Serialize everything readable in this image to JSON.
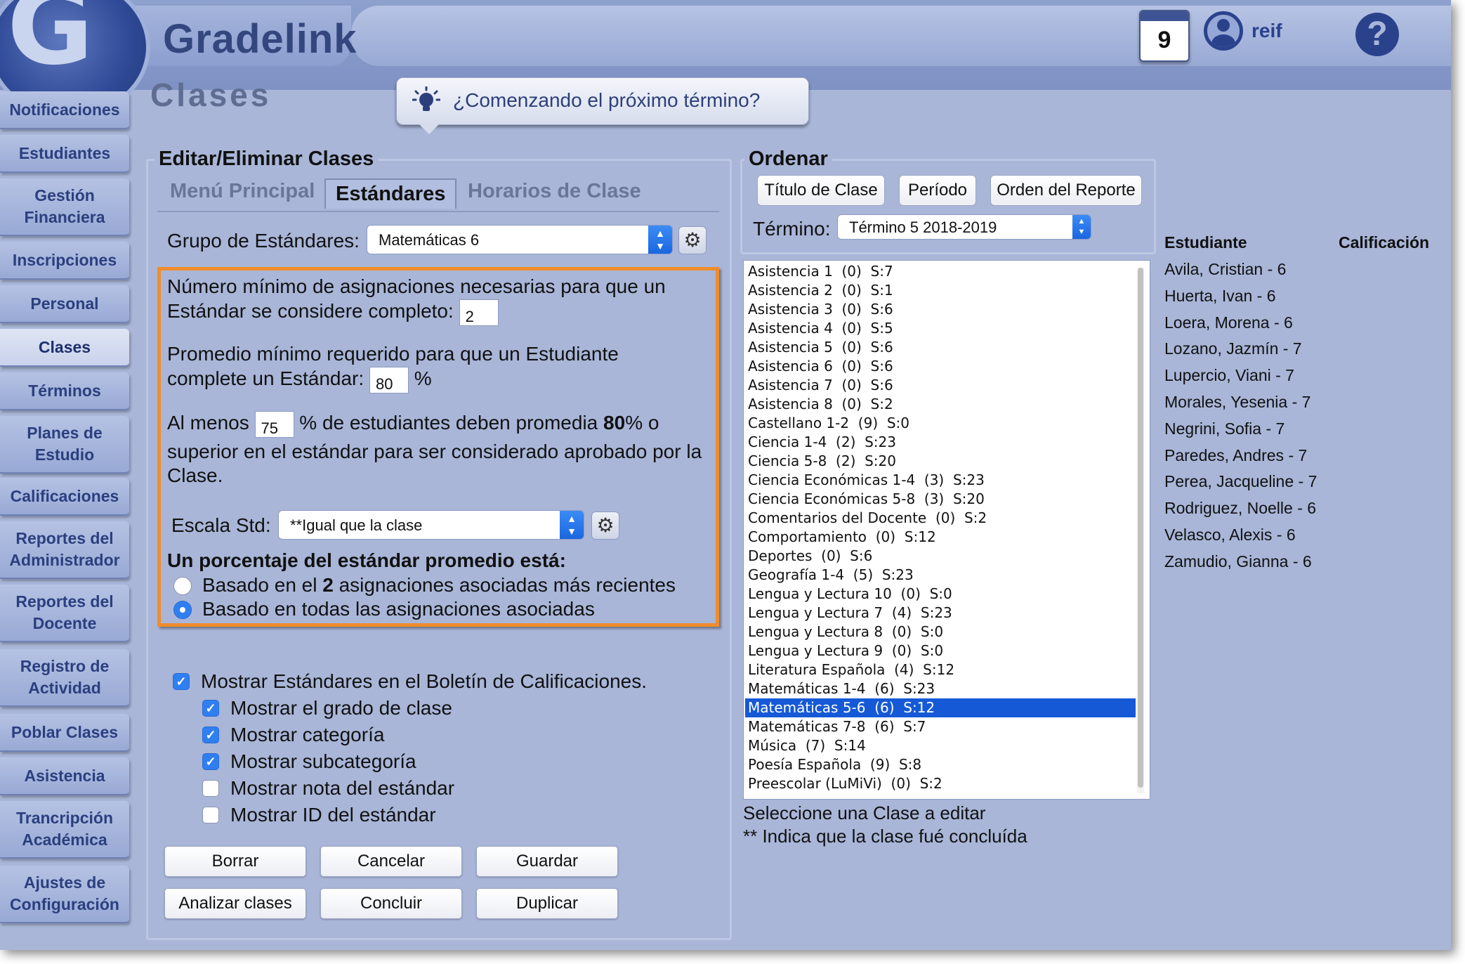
{
  "app": {
    "brand": "Gradelink",
    "logo_letter": "G",
    "calendar_day": "9",
    "username": "reif",
    "help_label": "?"
  },
  "sidebar": {
    "items": [
      {
        "label": "Notificaciones",
        "active": false
      },
      {
        "label": "Estudiantes",
        "active": false
      },
      {
        "label": "Gestión Financiera",
        "active": false
      },
      {
        "label": "Inscripciones",
        "active": false
      },
      {
        "label": "Personal",
        "active": false
      },
      {
        "label": "Clases",
        "active": true
      },
      {
        "label": "Términos",
        "active": false
      },
      {
        "label": "Planes de Estudio",
        "active": false
      },
      {
        "label": "Calificaciones",
        "active": false
      },
      {
        "label": "Reportes del Administrador",
        "active": false
      },
      {
        "label": "Reportes del Docente",
        "active": false
      },
      {
        "label": "Registro de Actividad",
        "active": false
      },
      {
        "label": "Poblar Clases",
        "active": false
      },
      {
        "label": "Asistencia",
        "active": false
      },
      {
        "label": "Trancripción Académica",
        "active": false
      },
      {
        "label": "Ajustes de Configuración",
        "active": false
      }
    ]
  },
  "page": {
    "title": "Clases",
    "tip": "¿Comenzando el próximo término?"
  },
  "edit": {
    "section_title": "Editar/Eliminar Clases",
    "tabs": [
      "Menú Principal",
      "Estándares",
      "Horarios de Clase"
    ],
    "active_tab": "Estándares",
    "group_label": "Grupo de Estándares:",
    "group_value": "Matemáticas 6",
    "min_assign_text_1": "Número mínimo de asignaciones necesarias para que un",
    "min_assign_text_2": "Estándar se considere completo:",
    "min_assign_value": "2",
    "min_avg_text_1": "Promedio mínimo requerido para que un Estudiante",
    "min_avg_text_2": "complete un Estándar:",
    "min_avg_value": "80",
    "min_avg_unit": "%",
    "atleast_prefix": "Al menos",
    "atleast_value": "75",
    "atleast_mid": "% de estudiantes deben promedia",
    "atleast_bold": "80",
    "atleast_suffix": "% o",
    "atleast_line2": "superior en el estándar para ser considerado aprobado por la",
    "atleast_line3": "Clase.",
    "scale_label": "Escala Std:",
    "scale_value": "**Igual que la clase",
    "pct_heading": "Un porcentaje del estándar promedio está:",
    "radio1_prefix": "Basado en el",
    "radio1_bold": "2",
    "radio1_suffix": "asignaciones asociadas más recientes",
    "radio2": "Basado en todas las asignaciones asociadas",
    "checks": [
      {
        "label": "Mostrar Estándares en el Boletín de Calificaciones.",
        "checked": true
      },
      {
        "label": "Mostrar el grado de clase",
        "checked": true
      },
      {
        "label": "Mostrar categoría",
        "checked": true
      },
      {
        "label": "Mostrar subcategoría",
        "checked": true
      },
      {
        "label": "Mostrar nota del estándar",
        "checked": false
      },
      {
        "label": "Mostrar ID del estándar",
        "checked": false
      }
    ],
    "buttons": [
      "Borrar",
      "Cancelar",
      "Guardar",
      "Analizar clases",
      "Concluir",
      "Duplicar"
    ]
  },
  "sort": {
    "section_title": "Ordenar",
    "buttons": [
      "Título de Clase",
      "Período",
      "Orden del Reporte"
    ],
    "term_label": "Término:",
    "term_value": "Término 5 2018-2019"
  },
  "class_list": {
    "items": [
      "Asistencia 1  (0)  S:7",
      "Asistencia 2  (0)  S:1",
      "Asistencia 3  (0)  S:6",
      "Asistencia 4  (0)  S:5",
      "Asistencia 5  (0)  S:6",
      "Asistencia 6  (0)  S:6",
      "Asistencia 7  (0)  S:6",
      "Asistencia 8  (0)  S:2",
      "Castellano 1-2  (9)  S:0",
      "Ciencia 1-4  (2)  S:23",
      "Ciencia 5-8  (2)  S:20",
      "Ciencia Económicas 1-4  (3)  S:23",
      "Ciencia Económicas 5-8  (3)  S:20",
      "Comentarios del Docente  (0)  S:2",
      "Comportamiento  (0)  S:12",
      "Deportes  (0)  S:6",
      "Geografía 1-4  (5)  S:23",
      "Lengua y Lectura 10  (0)  S:0",
      "Lengua y Lectura 7  (4)  S:23",
      "Lengua y Lectura 8  (0)  S:0",
      "Lengua y Lectura 9  (0)  S:0",
      "Literatura Española  (4)  S:12",
      "Matemáticas 1-4  (6)  S:23",
      "Matemáticas 5-6  (6)  S:12",
      "Matemáticas 7-8  (6)  S:7",
      "Música  (7)  S:14",
      "Poesía Española  (9)  S:8",
      "Preescolar (LuMiVi)  (0)  S:2"
    ],
    "selected_index": 23,
    "hint_1": "Seleccione una Clase a editar",
    "hint_2": "** Indica que la clase fué concluída"
  },
  "students": {
    "header_student": "Estudiante",
    "header_grade": "Calificación",
    "items": [
      "Avila, Cristian - 6",
      "Huerta, Ivan - 6",
      "Loera, Morena - 6",
      "Lozano, Jazmín - 7",
      "Lupercio, Viani - 7",
      "Morales, Yesenia - 7",
      "Negrini, Sofia - 7",
      "Paredes, Andres - 7",
      "Perea, Jacqueline - 7",
      "Rodriguez, Noelle - 6",
      "Velasco, Alexis - 6",
      "Zamudio, Gianna - 6"
    ]
  }
}
